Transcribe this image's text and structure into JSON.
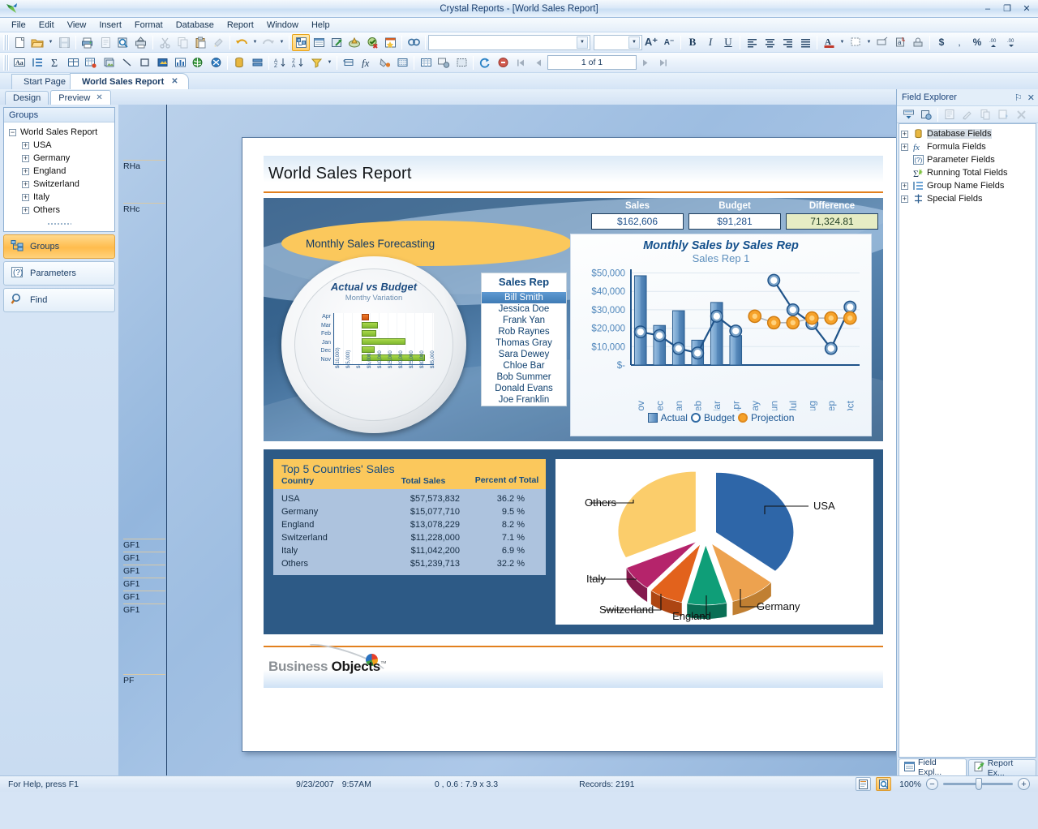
{
  "window": {
    "title": "Crystal Reports - [World Sales Report]",
    "minimize": "–",
    "maximize": "❐",
    "close": "✕"
  },
  "menu": [
    "File",
    "Edit",
    "View",
    "Insert",
    "Format",
    "Database",
    "Report",
    "Window",
    "Help"
  ],
  "toolbar": {
    "font_name": "",
    "font_size": "",
    "page_indicator": "1 of 1",
    "icons_row1": [
      "new-icon",
      "open-icon",
      "save-icon",
      "print-icon",
      "print-preview-icon",
      "export-icon",
      "print-setup-icon",
      "cut-icon",
      "copy-icon",
      "paste-icon",
      "format-painter-icon",
      "undo-icon",
      "redo-icon",
      "design-view-icon",
      "field-explorer-icon",
      "insert-field-icon",
      "preview-sample-icon",
      "check-errors-icon",
      "bookmark-icon",
      "find-icon"
    ],
    "icons_row2": [
      "text-object-icon",
      "group-icon",
      "summary-icon",
      "cross-tab-icon",
      "subreport-icon",
      "picture-icon",
      "line-icon",
      "box-icon",
      "ole-object-icon",
      "chart-icon",
      "map-icon",
      "flash-icon",
      "database-expert-icon",
      "section-expert-icon",
      "sort-ascending-icon",
      "sort-descending-icon",
      "select-expert-icon",
      "insert-group-icon",
      "formula-workshop-icon",
      "highlight-expert-icon",
      "grid-icon",
      "tooltip-icon",
      "preview-icon",
      "refresh-icon",
      "stop-icon",
      "first-page-icon",
      "previous-page-icon",
      "next-page-icon",
      "last-page-icon"
    ],
    "font_grow": "A⁺",
    "font_shrink": "A⁻",
    "bold": "B",
    "italic": "I",
    "underline": "U",
    "currency": "$",
    "percent": "%"
  },
  "doc_tabs": [
    {
      "label": "Start Page",
      "selected": false,
      "closable": false
    },
    {
      "label": "World Sales Report",
      "selected": true,
      "closable": true
    }
  ],
  "view_tabs": [
    {
      "label": "Design",
      "selected": false,
      "closable": false
    },
    {
      "label": "Preview",
      "selected": true,
      "closable": true
    }
  ],
  "groups_panel": {
    "header": "Groups",
    "root": "World Sales Report",
    "nodes": [
      "USA",
      "Germany",
      "England",
      "Switzerland",
      "Italy",
      "Others"
    ],
    "expand_glyph": "+",
    "collapse_glyph": "−",
    "buttons": [
      {
        "label": "Groups",
        "icon": "groups-tree-icon",
        "selected": true
      },
      {
        "label": "Parameters",
        "icon": "question-mark-icon",
        "selected": false
      },
      {
        "label": "Find",
        "icon": "magnifier-icon",
        "selected": false
      }
    ]
  },
  "section_markers": [
    "RHa",
    "RHc",
    "GF1",
    "GF1",
    "GF1",
    "GF1",
    "GF1",
    "GF1",
    "PF"
  ],
  "report": {
    "title": "World Sales Report",
    "forecast_banner": "Monthly Sales Forecasting",
    "kpis": [
      {
        "label": "Sales",
        "value": "$162,606",
        "highlight": false
      },
      {
        "label": "Budget",
        "value": "$91,281",
        "highlight": false
      },
      {
        "label": "Difference",
        "value": "71,324.81",
        "highlight": true
      }
    ],
    "gauge": {
      "title": "Actual vs Budget",
      "subtitle": "Monthy Variation"
    },
    "sales_rep_list": {
      "header": "Sales Rep",
      "items": [
        "Bill Smith",
        "Jessica Doe",
        "Frank Yan",
        "Rob Raynes",
        "Thomas Gray",
        "Sara Dewey",
        "Chloe Bar",
        "Bob Summer",
        "Donald Evans",
        "Joe Franklin"
      ],
      "selected": "Bill Smith"
    },
    "footer_logo": {
      "part1": "Business ",
      "part2": "Objects",
      "tm": "™"
    }
  },
  "chart_data": [
    {
      "type": "bar",
      "title": "Actual vs Budget",
      "subtitle": "Monthy Variation",
      "orientation": "horizontal",
      "categories": [
        "Apr",
        "Mar",
        "Feb",
        "Jan",
        "Dec",
        "Nov"
      ],
      "values": [
        -2400,
        7000,
        6000,
        19500,
        5500,
        29000
      ],
      "colors": [
        "#e2621c",
        "#8dc63f",
        "#8dc63f",
        "#8dc63f",
        "#8dc63f",
        "#8dc63f"
      ],
      "xlabel": "",
      "ylabel": "",
      "xticks": [
        "$(10,000)",
        "$(5,000)",
        "$-",
        "$5,000",
        "$10,000",
        "$15,000",
        "$20,000",
        "$25,000",
        "$30,000",
        "$35,000"
      ],
      "xlim": [
        -10000,
        35000
      ],
      "grid": true
    },
    {
      "type": "bar",
      "title": "Monthly Sales by Sales Rep",
      "subtitle": "Sales Rep 1",
      "categories": [
        "Nov",
        "Dec",
        "Jan",
        "Feb",
        "Mar",
        "Apr",
        "May",
        "Jun",
        "Jul",
        "Aug",
        "Sep",
        "Oct"
      ],
      "series": [
        {
          "name": "Actual",
          "type": "bar",
          "color": "#4d82b8",
          "values": [
            48500,
            21500,
            29500,
            13500,
            34000,
            16000,
            null,
            null,
            null,
            null,
            null,
            null
          ]
        },
        {
          "name": "Budget",
          "type": "line",
          "color": "#2f6aa3",
          "values": [
            18000,
            16000,
            9000,
            6500,
            26500,
            18500,
            null,
            46000,
            30000,
            22500,
            9000,
            31500
          ]
        },
        {
          "name": "Projection",
          "type": "line",
          "color": "#f6a22a",
          "values": [
            null,
            null,
            null,
            null,
            null,
            null,
            26500,
            23000,
            23000,
            25500,
            25500,
            25500
          ]
        }
      ],
      "ylabel": "",
      "yticks": [
        "$-",
        "$10,000",
        "$20,000",
        "$30,000",
        "$40,000",
        "$50,000"
      ],
      "ylim": [
        0,
        52000
      ],
      "legend": [
        "Actual",
        "Budget",
        "Projection"
      ],
      "legend_position": "bottom",
      "grid": true
    },
    {
      "type": "table",
      "title": "Top 5 Countries' Sales",
      "columns": [
        "Country",
        "Total Sales",
        "Percent of Total"
      ],
      "rows": [
        [
          "USA",
          "$57,573,832",
          "36.2 %"
        ],
        [
          "Germany",
          "$15,077,710",
          "9.5 %"
        ],
        [
          "England",
          "$13,078,229",
          "8.2 %"
        ],
        [
          "Switzerland",
          "$11,228,000",
          "7.1 %"
        ],
        [
          "Italy",
          "$11,042,200",
          "6.9 %"
        ],
        [
          "Others",
          "$51,239,713",
          "32.2 %"
        ]
      ]
    },
    {
      "type": "pie",
      "title": "",
      "exploded": true,
      "three_d": true,
      "labels": [
        "USA",
        "Germany",
        "England",
        "Switzerland",
        "Italy",
        "Others"
      ],
      "values": [
        36.2,
        9.5,
        8.2,
        7.1,
        6.9,
        32.2
      ],
      "colors": [
        "#2e66a8",
        "#edа24f",
        "#0f9e78",
        "#e2621c",
        "#b5246b",
        "#fbcd6b"
      ]
    }
  ],
  "field_explorer": {
    "title": "Field Explorer",
    "pin": "⚐",
    "close": "✕",
    "toolbar_icons": [
      "insert-to-report-icon",
      "browse-data-icon",
      "new-formula-icon",
      "edit-icon",
      "rename-icon",
      "duplicate-icon",
      "delete-icon"
    ],
    "nodes": [
      {
        "label": "Database Fields",
        "icon": "database-icon",
        "expandable": true,
        "selected": true
      },
      {
        "label": "Formula Fields",
        "icon": "formula-icon",
        "expandable": true,
        "selected": false
      },
      {
        "label": "Parameter Fields",
        "icon": "parameter-icon",
        "expandable": false,
        "selected": false
      },
      {
        "label": "Running Total Fields",
        "icon": "sigma-icon",
        "expandable": false,
        "selected": false
      },
      {
        "label": "Group Name Fields",
        "icon": "group-name-icon",
        "expandable": true,
        "selected": false
      },
      {
        "label": "Special Fields",
        "icon": "special-fields-icon",
        "expandable": true,
        "selected": false
      }
    ],
    "panel_tabs": [
      {
        "label": "Field Expl...",
        "icon": "field-explorer-icon",
        "selected": true
      },
      {
        "label": "Report Ex...",
        "icon": "report-explorer-icon",
        "selected": false
      }
    ]
  },
  "status_bar": {
    "help": "For Help, press F1",
    "date": "9/23/2007",
    "time": "9:57AM",
    "coords": "0 , 0.6 : 7.9 x 3.3",
    "records": "Records:  2191",
    "zoom": "100%",
    "zoom_out": "−",
    "zoom_in": "+"
  }
}
